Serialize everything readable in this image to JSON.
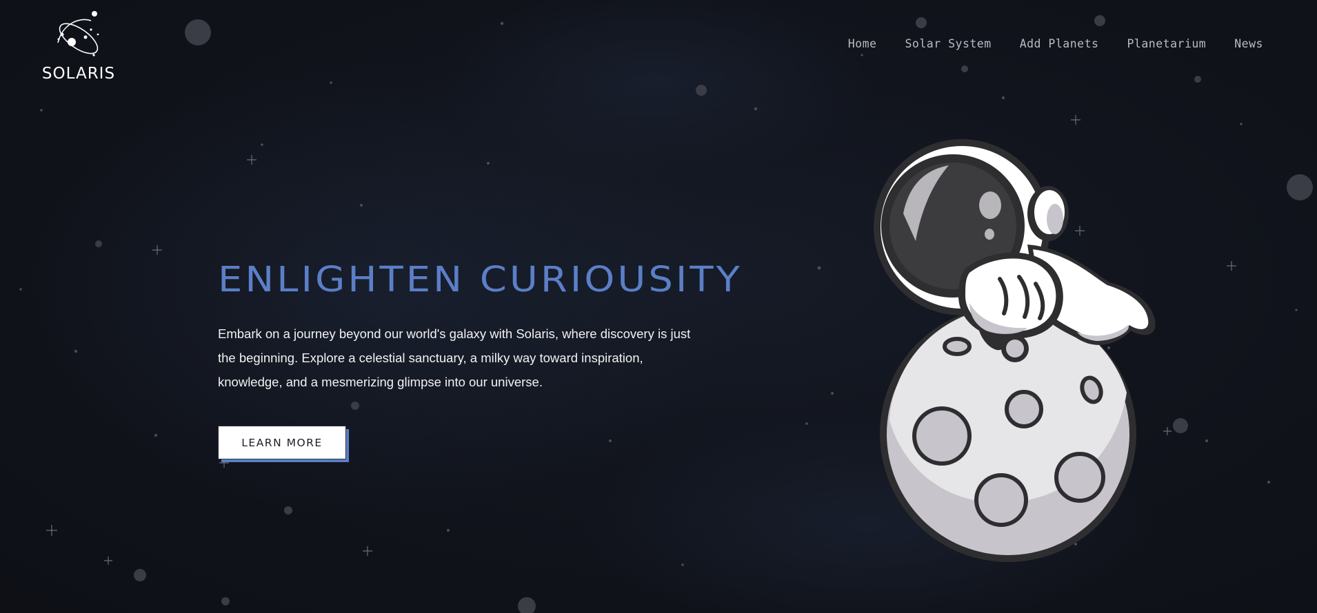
{
  "brand": {
    "name": "SOLARIS",
    "logo_icon": "planet-orbit-icon"
  },
  "nav": {
    "items": [
      {
        "label": "Home"
      },
      {
        "label": "Solar System"
      },
      {
        "label": "Add Planets"
      },
      {
        "label": "Planetarium"
      },
      {
        "label": "News"
      }
    ]
  },
  "hero": {
    "title": "ENLIGHTEN CURIOUSITY",
    "description": "Embark on a journey beyond our world's galaxy with Solaris, where discovery is just the beginning. Explore a celestial sanctuary, a milky way toward inspiration, knowledge, and a mesmerizing glimpse into our universe.",
    "cta_label": "LEARN MORE",
    "illustration": "astronaut-on-moon-illustration"
  },
  "colors": {
    "background": "#11141c",
    "accent": "#5b7fc7",
    "nav_text": "#b9bcc4",
    "button_bg": "#ffffff",
    "moon": "#e4e4e8",
    "crater": "#c8c4cc"
  }
}
